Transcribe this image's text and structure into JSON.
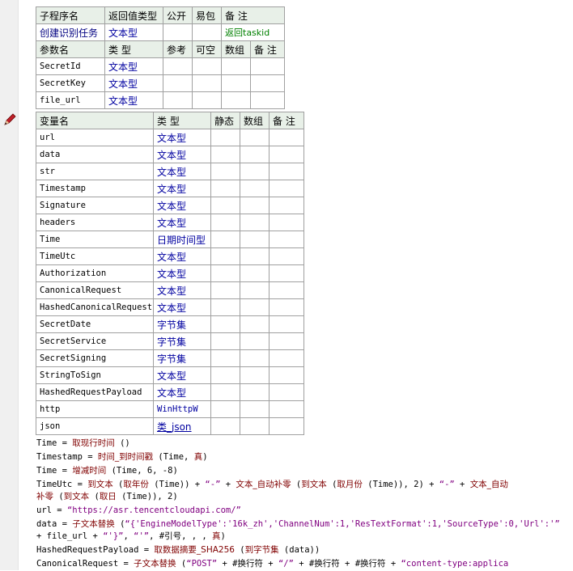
{
  "sub": {
    "headers": [
      "子程序名",
      "返回值类型",
      "公开",
      "易包",
      "备 注"
    ],
    "name": "创建识别任务",
    "return_type": "文本型",
    "remark": "返回taskid",
    "param_headers": [
      "参数名",
      "类 型",
      "参考",
      "可空",
      "数组",
      "备 注"
    ],
    "params": [
      {
        "name": "SecretId",
        "type": "文本型"
      },
      {
        "name": "SecretKey",
        "type": "文本型"
      },
      {
        "name": "file_url",
        "type": "文本型"
      }
    ]
  },
  "vars": {
    "headers": [
      "变量名",
      "类 型",
      "静态",
      "数组",
      "备 注"
    ],
    "rows": [
      {
        "name": "url",
        "type": "文本型"
      },
      {
        "name": "data",
        "type": "文本型"
      },
      {
        "name": "str",
        "type": "文本型"
      },
      {
        "name": "Timestamp",
        "type": "文本型"
      },
      {
        "name": "Signature",
        "type": "文本型"
      },
      {
        "name": "headers",
        "type": "文本型"
      },
      {
        "name": "Time",
        "type": "日期时间型"
      },
      {
        "name": "TimeUtc",
        "type": "文本型"
      },
      {
        "name": "Authorization",
        "type": "文本型"
      },
      {
        "name": "CanonicalRequest",
        "type": "文本型"
      },
      {
        "name": "HashedCanonicalRequest",
        "type": "文本型"
      },
      {
        "name": "SecretDate",
        "type": "字节集"
      },
      {
        "name": "SecretService",
        "type": "字节集"
      },
      {
        "name": "SecretSigning",
        "type": "字节集"
      },
      {
        "name": "StringToSign",
        "type": "文本型"
      },
      {
        "name": "HashedRequestPayload",
        "type": "文本型"
      },
      {
        "name": "http",
        "type": "WinHttpW"
      },
      {
        "name": "json",
        "type": "类_json"
      }
    ]
  },
  "code": [
    [
      {
        "t": "Time = "
      },
      {
        "t": "取现行时间",
        "c": "fn"
      },
      {
        "t": " ()"
      }
    ],
    [
      {
        "t": "Timestamp = "
      },
      {
        "t": "时间_到时间戳",
        "c": "fn"
      },
      {
        "t": " (Time, "
      },
      {
        "t": "真",
        "c": "kw"
      },
      {
        "t": ")"
      }
    ],
    [
      {
        "t": "Time = "
      },
      {
        "t": "增减时间",
        "c": "fn"
      },
      {
        "t": " (Time, 6, -8)"
      }
    ],
    [
      {
        "t": "TimeUtc = "
      },
      {
        "t": "到文本",
        "c": "fn"
      },
      {
        "t": " ("
      },
      {
        "t": "取年份",
        "c": "fn"
      },
      {
        "t": " (Time)) + "
      },
      {
        "t": "“-”",
        "c": "str"
      },
      {
        "t": " + "
      },
      {
        "t": "文本_自动补零",
        "c": "fn"
      },
      {
        "t": " ("
      },
      {
        "t": "到文本",
        "c": "fn"
      },
      {
        "t": " ("
      },
      {
        "t": "取月份",
        "c": "fn"
      },
      {
        "t": " (Time)), 2) + "
      },
      {
        "t": "“-”",
        "c": "str"
      },
      {
        "t": " + "
      },
      {
        "t": "文本_自动",
        "c": "fn"
      }
    ],
    [
      {
        "t": "补零",
        "c": "fn"
      },
      {
        "t": " ("
      },
      {
        "t": "到文本",
        "c": "fn"
      },
      {
        "t": " ("
      },
      {
        "t": "取日",
        "c": "fn"
      },
      {
        "t": " (Time)), 2)"
      }
    ],
    [
      {
        "t": "url = "
      },
      {
        "t": "“https://asr.tencentcloudapi.com/”",
        "c": "str"
      }
    ],
    [
      {
        "t": "data = "
      },
      {
        "t": "子文本替换",
        "c": "fn"
      },
      {
        "t": " ("
      },
      {
        "t": "“{'EngineModelType':'16k_zh','ChannelNum':1,'ResTextFormat':1,'SourceType':0,'Url':'”",
        "c": "str"
      }
    ],
    [
      {
        "t": " + file_url + "
      },
      {
        "t": "“'}”",
        "c": "str"
      },
      {
        "t": ", "
      },
      {
        "t": "“'”",
        "c": "str"
      },
      {
        "t": ", #引号, , , "
      },
      {
        "t": "真",
        "c": "kw"
      },
      {
        "t": ")"
      }
    ],
    [
      {
        "t": "HashedRequestPayload = "
      },
      {
        "t": "取数据摘要_SHA256",
        "c": "fn"
      },
      {
        "t": " ("
      },
      {
        "t": "到字节集",
        "c": "fn"
      },
      {
        "t": " (data))"
      }
    ],
    [
      {
        "t": "CanonicalRequest = "
      },
      {
        "t": "子文本替换",
        "c": "fn"
      },
      {
        "t": " ("
      },
      {
        "t": "“POST”",
        "c": "str"
      },
      {
        "t": " + #换行符 + "
      },
      {
        "t": "“/”",
        "c": "str"
      },
      {
        "t": " + #换行符 + #换行符 + "
      },
      {
        "t": "“content-type:applica",
        "c": "str"
      }
    ]
  ]
}
